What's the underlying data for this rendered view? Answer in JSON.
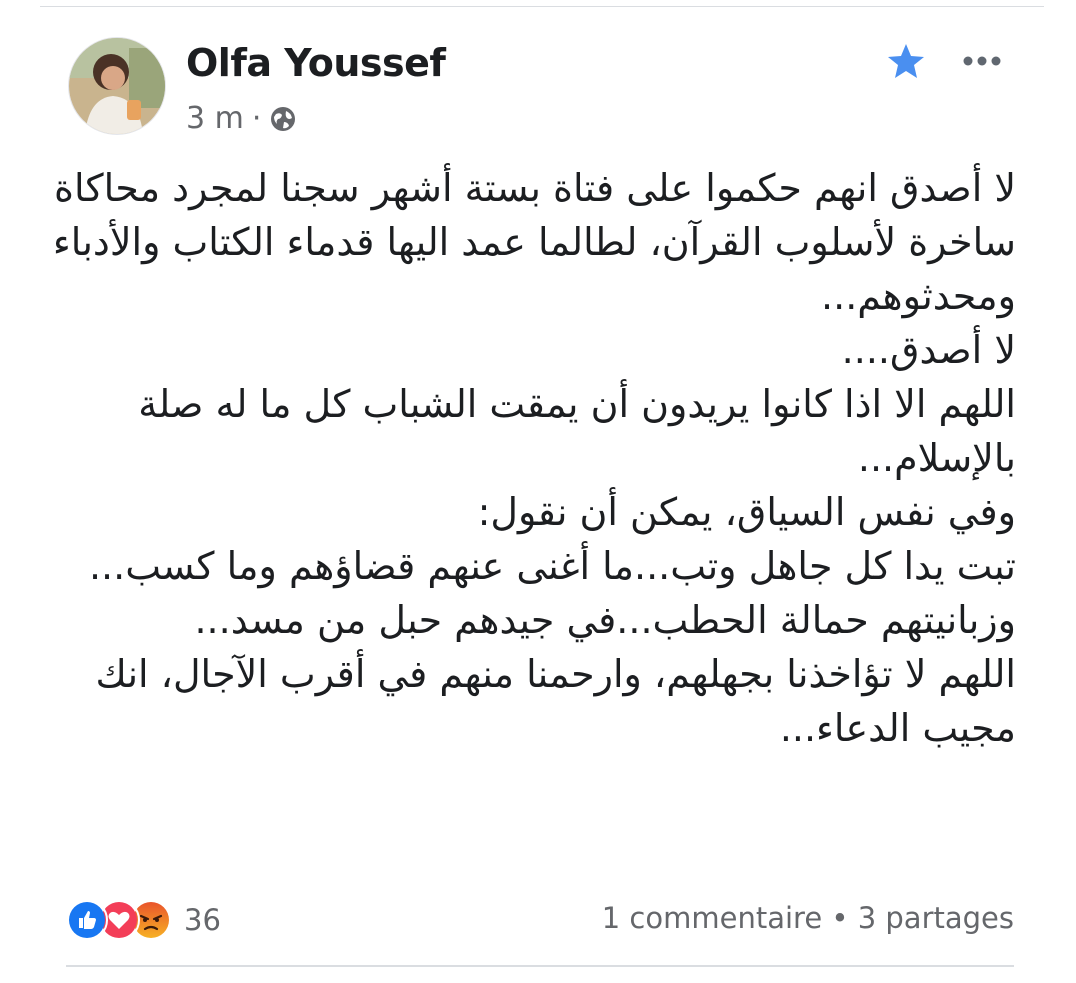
{
  "post": {
    "author": "Olfa Youssef",
    "time": "3 m",
    "separator": "·",
    "privacy_icon": "globe-icon",
    "favorite_icon": "star-icon",
    "menu_icon": "more-options-icon",
    "accent_color": "#4a8ff0",
    "text_lines": [
      "لا أصدق انهم حكموا على فتاة بستة أشهر سجنا لمجرد محاكاة",
      "ساخرة لأسلوب القرآن، لطالما عمد اليها قدماء الكتاب والأدباء",
      "ومحدثوهم...",
      "لا أصدق....",
      "اللهم الا اذا كانوا يريدون أن يمقت الشباب كل ما له صلة",
      "بالإسلام...",
      "وفي نفس السياق، يمكن أن نقول:",
      "تبت يدا كل جاهل وتب...ما أغنى عنهم قضاؤهم وما كسب...",
      "وزبانيتهم حمالة الحطب...في جيدهم حبل من مسد...",
      "اللهم لا تؤاخذنا بجهلهم، وارحمنا منهم في أقرب الآجال، انك",
      "مجيب الدعاء..."
    ]
  },
  "footer": {
    "reaction_icons": [
      "like-icon",
      "love-icon",
      "angry-icon"
    ],
    "reaction_count": "36",
    "comments": "1 commentaire",
    "stats_separator": "•",
    "shares": "3 partages"
  }
}
